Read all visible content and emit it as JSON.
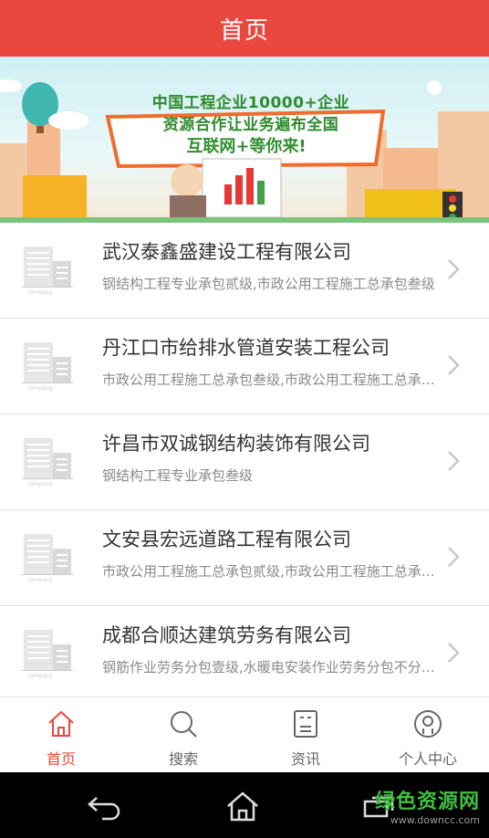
{
  "header": {
    "title": "首页"
  },
  "banner": {
    "line1": "中国工程企业10000+企业",
    "line2": "资源合作让业务遍布全国",
    "line3": "互联网+等你来!"
  },
  "companies": [
    {
      "name": "武汉泰鑫盛建设工程有限公司",
      "desc": "钢结构工程专业承包贰级,市政公用工程施工总承包叁级"
    },
    {
      "name": "丹江口市给排水管道安装工程公司",
      "desc": "市政公用工程施工总承包叁级,市政公用工程施工总承包贰级"
    },
    {
      "name": "许昌市双诚钢结构装饰有限公司",
      "desc": "钢结构工程专业承包叁级"
    },
    {
      "name": "文安县宏远道路工程有限公司",
      "desc": "市政公用工程施工总承包贰级,市政公用工程施工总承包叁级"
    },
    {
      "name": "成都合顺达建筑劳务有限公司",
      "desc": "钢筋作业劳务分包壹级,水暖电安装作业劳务分包不分等级"
    }
  ],
  "tabs": [
    {
      "label": "首页",
      "icon": "home-icon",
      "active": true
    },
    {
      "label": "搜索",
      "icon": "search-icon",
      "active": false
    },
    {
      "label": "资讯",
      "icon": "news-icon",
      "active": false
    },
    {
      "label": "个人中心",
      "icon": "user-icon",
      "active": false
    }
  ],
  "watermark": {
    "main": "绿色资源网",
    "sub": "www.downcc.com"
  },
  "colors": {
    "accent": "#e8483e",
    "banner_text": "#2e8b2e"
  }
}
